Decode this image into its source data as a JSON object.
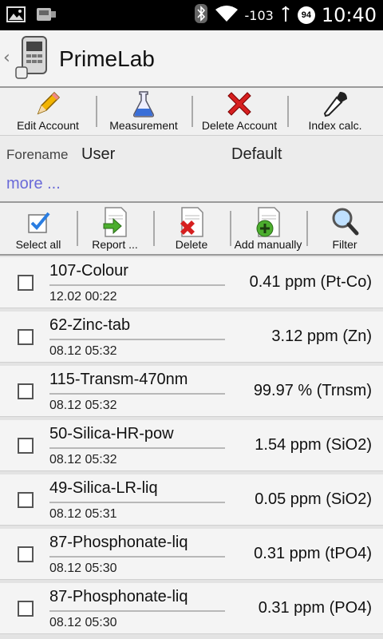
{
  "status_bar": {
    "signal_text": "-103",
    "badge": "94",
    "time": "10:40"
  },
  "action_bar": {
    "title": "PrimeLab"
  },
  "top_toolbar": {
    "items": [
      {
        "label": "Edit Account",
        "icon": "pencil-icon"
      },
      {
        "label": "Measurement",
        "icon": "flask-icon"
      },
      {
        "label": "Delete Account",
        "icon": "red-x-icon"
      },
      {
        "label": "Index calc.",
        "icon": "pipette-icon"
      }
    ]
  },
  "account": {
    "forename_label": "Forename",
    "forename_value": "User",
    "profile": "Default",
    "more_link": "more ..."
  },
  "list_toolbar": {
    "items": [
      {
        "label": "Select all",
        "icon": "checkmark-icon"
      },
      {
        "label": "Report ...",
        "icon": "report-arrow-icon"
      },
      {
        "label": "Delete",
        "icon": "delete-document-icon"
      },
      {
        "label": "Add manually",
        "icon": "add-document-icon"
      },
      {
        "label": "Filter",
        "icon": "magnifier-icon"
      }
    ]
  },
  "measurements": [
    {
      "name": "107-Colour",
      "date": "12.02 00:22",
      "value": "0.41 ppm (Pt-Co)"
    },
    {
      "name": "62-Zinc-tab",
      "date": "08.12 05:32",
      "value": "3.12 ppm (Zn)"
    },
    {
      "name": "115-Transm-470nm",
      "date": "08.12 05:32",
      "value": "99.97 % (Trnsm)"
    },
    {
      "name": "50-Silica-HR-pow",
      "date": "08.12 05:32",
      "value": "1.54 ppm (SiO2)"
    },
    {
      "name": "49-Silica-LR-liq",
      "date": "08.12 05:31",
      "value": "0.05 ppm (SiO2)"
    },
    {
      "name": "87-Phosphonate-liq",
      "date": "08.12 05:30",
      "value": "0.31 ppm (tPO4)"
    },
    {
      "name": "87-Phosphonate-liq",
      "date": "08.12 05:30",
      "value": "0.31 ppm (PO4)"
    }
  ]
}
